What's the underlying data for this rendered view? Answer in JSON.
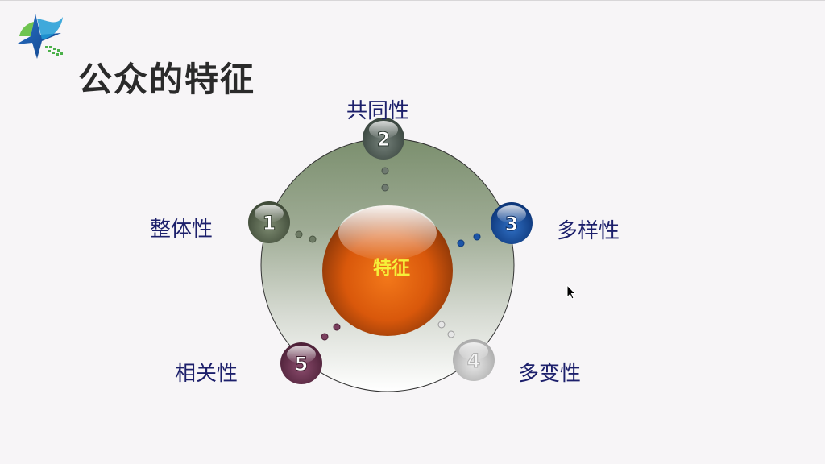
{
  "slide": {
    "title": "公众的特征"
  },
  "diagram": {
    "center_label": "特征",
    "nodes": [
      {
        "number": "1",
        "label": "整体性",
        "color": "#5d6b52"
      },
      {
        "number": "2",
        "label": "共同性",
        "color": "#58645a"
      },
      {
        "number": "3",
        "label": "多样性",
        "color": "#1b4f9a"
      },
      {
        "number": "4",
        "label": "多变性",
        "color": "#bcbcbc"
      },
      {
        "number": "5",
        "label": "相关性",
        "color": "#6b3552"
      }
    ]
  },
  "colors": {
    "label_text": "#1c1f6b",
    "center_sphere": "#e8620e",
    "center_text": "#f5f03a",
    "ring_top": "#7d9070"
  }
}
